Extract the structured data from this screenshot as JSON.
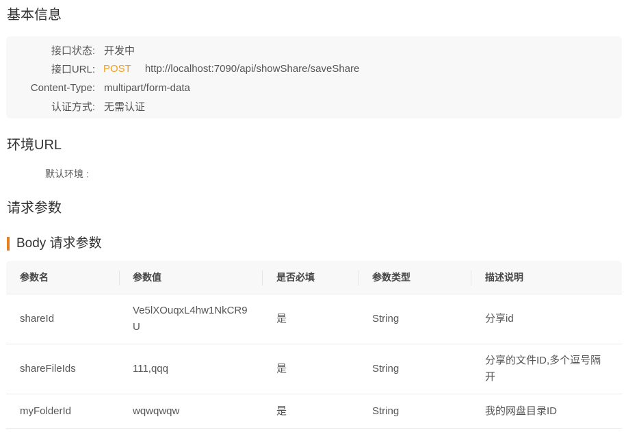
{
  "basic": {
    "title": "基本信息",
    "rows": [
      {
        "label": "接口状态:",
        "value": "开发中"
      },
      {
        "label": "接口URL:",
        "method": "POST",
        "value": "http://localhost:7090/api/showShare/saveShare"
      },
      {
        "label": "Content-Type:",
        "value": "multipart/form-data"
      },
      {
        "label": "认证方式:",
        "value": "无需认证"
      }
    ]
  },
  "env": {
    "title": "环境URL",
    "default_label": "默认环境 :"
  },
  "request": {
    "title": "请求参数",
    "body_title": "Body 请求参数",
    "columns": [
      "参数名",
      "参数值",
      "是否必填",
      "参数类型",
      "描述说明"
    ],
    "rows": [
      {
        "name": "shareId",
        "value": "Ve5lXOuqxL4hw1NkCR9U",
        "required": "是",
        "type": "String",
        "desc": "分享id"
      },
      {
        "name": "shareFileIds",
        "value": "111,qqq",
        "required": "是",
        "type": "String",
        "desc": "分享的文件ID,多个逗号隔开"
      },
      {
        "name": "myFolderId",
        "value": "wqwqwqw",
        "required": "是",
        "type": "String",
        "desc": "我的网盘目录ID"
      }
    ]
  },
  "colors": {
    "method": "#f0a020",
    "accent": "#e67e22"
  }
}
